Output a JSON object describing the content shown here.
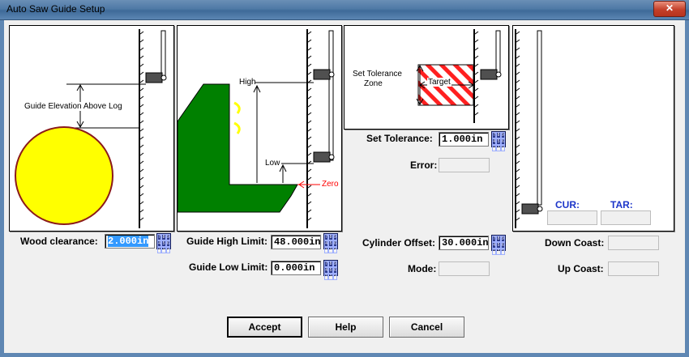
{
  "window": {
    "title": "Auto Saw Guide Setup",
    "close_glyph": "✕"
  },
  "diagrams": {
    "guide_elevation_label": "Guide Elevation Above Log",
    "high_label": "High",
    "low_label": "Low",
    "zero_label": "Zero",
    "tolerance_zone_line1": "Set Tolerance",
    "tolerance_zone_line2": "Zone",
    "target_label": "Target",
    "cur_label": "CUR:",
    "tar_label": "TAR:",
    "colors": {
      "log": "#ffff00",
      "log_outline": "#8b1a1a",
      "guide_body": "#008000",
      "zero_line": "#ff0000",
      "hatch": "#ff2020",
      "arc": "#ffff00"
    }
  },
  "fields": {
    "wood_clearance": {
      "label": "Wood clearance:",
      "value": "2.000in"
    },
    "guide_high_limit": {
      "label": "Guide High Limit:",
      "value": "48.000in"
    },
    "guide_low_limit": {
      "label": "Guide Low Limit:",
      "value": "0.000in"
    },
    "set_tolerance": {
      "label": "Set Tolerance:",
      "value": "1.000in"
    },
    "error": {
      "label": "Error:",
      "value": ""
    },
    "cylinder_offset": {
      "label": "Cylinder Offset:",
      "value": "30.000in"
    },
    "mode": {
      "label": "Mode:",
      "value": ""
    },
    "down_coast": {
      "label": "Down Coast:",
      "value": ""
    },
    "up_coast": {
      "label": "Up Coast:",
      "value": ""
    },
    "cur": {
      "value": ""
    },
    "tar": {
      "value": ""
    }
  },
  "keypad_digits": [
    "7",
    "8",
    "9",
    "4",
    "5",
    "6",
    "1",
    "2",
    "3"
  ],
  "buttons": {
    "accept": "Accept",
    "help": "Help",
    "cancel": "Cancel"
  }
}
